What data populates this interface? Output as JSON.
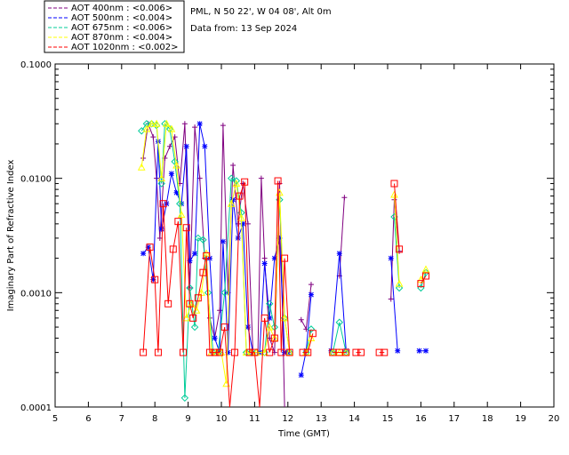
{
  "chart_data": {
    "type": "line",
    "xlabel": "Time (GMT)",
    "ylabel": "Imaginary Part of Refractive Index",
    "xlim": [
      5,
      20
    ],
    "ylim": [
      0.0001,
      0.1
    ],
    "yscale": "log",
    "x_ticks": [
      "5",
      "6",
      "7",
      "8",
      "9",
      "10",
      "11",
      "12",
      "13",
      "14",
      "15",
      "16",
      "17",
      "18",
      "19",
      "20"
    ],
    "y_ticks": [
      {
        "value": 0.1,
        "label": "0.1000"
      },
      {
        "value": 0.01,
        "label": "0.0100"
      },
      {
        "value": 0.001,
        "label": "0.0010"
      },
      {
        "value": 0.0001,
        "label": "0.0001"
      }
    ],
    "info_lines": [
      "PML, N 50 22', W 04 08', Alt 0m",
      "Data from: 13 Sep 2024"
    ],
    "legend_position": "top-left-outside",
    "series": [
      {
        "name": "AOT  400nm : <0.006>",
        "color": "#800080",
        "marker": "plus",
        "segments": [
          [
            [
              7.65,
              0.015
            ],
            [
              7.8,
              0.03
            ],
            [
              7.95,
              0.023
            ],
            [
              8.05,
              0.01
            ],
            [
              8.15,
              0.003
            ],
            [
              8.3,
              0.015
            ],
            [
              8.45,
              0.019
            ],
            [
              8.6,
              0.023
            ],
            [
              8.75,
              0.009
            ],
            [
              8.9,
              0.03
            ],
            [
              9.05,
              0.0011
            ],
            [
              9.2,
              0.028
            ],
            [
              9.35,
              0.01
            ],
            [
              9.5,
              0.002
            ],
            [
              9.65,
              0.0006
            ],
            [
              9.8,
              0.0004
            ],
            [
              9.95,
              0.0007
            ],
            [
              10.05,
              0.029
            ],
            [
              10.2,
              0.001
            ],
            [
              10.35,
              0.013
            ],
            [
              10.5,
              0.004
            ],
            [
              10.65,
              0.009
            ],
            [
              10.8,
              0.004
            ],
            [
              10.95,
              0.0003
            ],
            [
              11.1,
              0.0003
            ],
            [
              11.2,
              0.01
            ],
            [
              11.3,
              0.002
            ],
            [
              11.45,
              0.0004
            ],
            [
              11.6,
              0.0003
            ],
            [
              11.75,
              0.009
            ],
            [
              11.9,
              6e-05
            ]
          ],
          [
            [
              12.4,
              0.00058
            ],
            [
              12.55,
              0.00048
            ],
            [
              12.7,
              0.00118
            ]
          ],
          [
            [
              13.55,
              0.0014
            ],
            [
              13.7,
              0.0068
            ]
          ],
          [
            [
              15.1,
              0.00088
            ],
            [
              15.2,
              0.0065
            ],
            [
              15.35,
              0.0023
            ]
          ]
        ]
      },
      {
        "name": "AOT  500nm : <0.004>",
        "color": "#0000ff",
        "marker": "star",
        "segments": [
          [
            [
              7.65,
              0.0022
            ],
            [
              7.8,
              0.0025
            ],
            [
              7.95,
              0.0013
            ],
            [
              8.1,
              0.021
            ],
            [
              8.2,
              0.0036
            ],
            [
              8.35,
              0.006
            ],
            [
              8.5,
              0.011
            ],
            [
              8.65,
              0.0075
            ],
            [
              8.8,
              0.006
            ],
            [
              8.95,
              0.019
            ],
            [
              9.05,
              0.0019
            ],
            [
              9.2,
              0.0022
            ],
            [
              9.35,
              0.03
            ],
            [
              9.5,
              0.019
            ],
            [
              9.65,
              0.002
            ],
            [
              9.8,
              0.0004
            ],
            [
              9.95,
              0.0003
            ],
            [
              10.05,
              0.0028
            ],
            [
              10.2,
              0.0003
            ],
            [
              10.35,
              0.0065
            ],
            [
              10.5,
              0.003
            ],
            [
              10.65,
              0.004
            ],
            [
              10.8,
              0.0005
            ],
            [
              10.95,
              0.0003
            ],
            [
              11.15,
              0.0003
            ],
            [
              11.3,
              0.0018
            ],
            [
              11.45,
              0.0006
            ],
            [
              11.6,
              0.002
            ],
            [
              11.75,
              0.003
            ],
            [
              11.9,
              0.0003
            ],
            [
              12.0,
              0.0003
            ]
          ],
          [
            [
              12.4,
              0.00019
            ],
            [
              12.55,
              0.00031
            ],
            [
              12.7,
              0.00096
            ]
          ],
          [
            [
              13.3,
              0.00031
            ],
            [
              13.55,
              0.0022
            ],
            [
              13.75,
              0.00031
            ]
          ],
          [
            [
              15.1,
              0.002
            ],
            [
              15.3,
              0.00031
            ]
          ],
          [
            [
              15.95,
              0.00031
            ],
            [
              16.15,
              0.00031
            ]
          ]
        ]
      },
      {
        "name": "AOT  675nm : <0.006>",
        "color": "#00cc99",
        "marker": "diamond",
        "segments": [
          [
            [
              7.6,
              0.026
            ],
            [
              7.75,
              0.03
            ],
            [
              7.9,
              0.03
            ],
            [
              8.05,
              0.029
            ],
            [
              8.2,
              0.009
            ],
            [
              8.3,
              0.03
            ],
            [
              8.45,
              0.027
            ],
            [
              8.6,
              0.014
            ],
            [
              8.75,
              0.006
            ],
            [
              8.9,
              0.00012
            ],
            [
              9.05,
              0.0011
            ],
            [
              9.2,
              0.0005
            ],
            [
              9.3,
              0.003
            ],
            [
              9.45,
              0.0029
            ],
            [
              9.6,
              0.001
            ],
            [
              9.75,
              0.0003
            ],
            [
              9.9,
              0.0003
            ],
            [
              10.1,
              0.001
            ],
            [
              10.3,
              0.01
            ],
            [
              10.45,
              0.0095
            ],
            [
              10.6,
              0.005
            ],
            [
              10.75,
              0.0003
            ],
            [
              10.9,
              0.0003
            ],
            [
              11.05,
              0.0003
            ],
            [
              11.3,
              0.0003
            ],
            [
              11.45,
              0.0008
            ],
            [
              11.6,
              0.0005
            ],
            [
              11.75,
              0.0065
            ],
            [
              11.9,
              0.0006
            ],
            [
              12.05,
              0.0003
            ]
          ],
          [
            [
              12.55,
              0.0003
            ],
            [
              12.7,
              0.00048
            ]
          ],
          [
            [
              13.35,
              0.0003
            ],
            [
              13.55,
              0.00055
            ],
            [
              13.75,
              0.0003
            ]
          ],
          [
            [
              15.2,
              0.0046
            ],
            [
              15.35,
              0.0011
            ]
          ],
          [
            [
              16.0,
              0.0011
            ],
            [
              16.15,
              0.0015
            ]
          ]
        ]
      },
      {
        "name": "AOT  870nm : <0.004>",
        "color": "#ffff00",
        "marker": "triangle",
        "segments": [
          [
            [
              7.6,
              0.0125
            ],
            [
              7.75,
              0.027
            ],
            [
              7.9,
              0.03
            ],
            [
              8.05,
              0.03
            ],
            [
              8.2,
              0.01
            ],
            [
              8.35,
              0.03
            ],
            [
              8.5,
              0.027
            ],
            [
              8.65,
              0.013
            ],
            [
              8.8,
              0.0048
            ],
            [
              8.95,
              0.0006
            ],
            [
              9.1,
              0.0008
            ],
            [
              9.25,
              0.0007
            ],
            [
              9.4,
              0.001
            ],
            [
              9.55,
              0.0022
            ],
            [
              9.7,
              0.0003
            ],
            [
              9.85,
              0.0003
            ],
            [
              10.0,
              0.0003
            ],
            [
              10.15,
              0.00016
            ],
            [
              10.3,
              0.006
            ],
            [
              10.45,
              0.009
            ],
            [
              10.6,
              0.0045
            ],
            [
              10.75,
              0.0003
            ],
            [
              10.9,
              0.0003
            ],
            [
              11.05,
              0.0003
            ],
            [
              11.3,
              0.0003
            ],
            [
              11.45,
              0.0005
            ],
            [
              11.6,
              0.0004
            ],
            [
              11.75,
              0.0075
            ],
            [
              11.9,
              0.0006
            ],
            [
              12.05,
              0.0003
            ]
          ],
          [
            [
              12.55,
              0.0003
            ],
            [
              12.7,
              0.0004
            ]
          ],
          [
            [
              13.35,
              0.0003
            ],
            [
              13.55,
              0.0003
            ],
            [
              13.75,
              0.0003
            ]
          ],
          [
            [
              15.2,
              0.0072
            ],
            [
              15.35,
              0.0012
            ]
          ],
          [
            [
              16.0,
              0.0013
            ],
            [
              16.15,
              0.0016
            ]
          ]
        ]
      },
      {
        "name": "AOT 1020nm : <0.002>",
        "color": "#ff0000",
        "marker": "square",
        "segments": [
          [
            [
              7.65,
              0.0003
            ],
            [
              7.85,
              0.0025
            ],
            [
              8.0,
              0.0013
            ],
            [
              8.1,
              0.0003
            ],
            [
              8.25,
              0.006
            ],
            [
              8.4,
              0.0008
            ],
            [
              8.55,
              0.0024
            ],
            [
              8.7,
              0.0042
            ],
            [
              8.85,
              0.0003
            ],
            [
              8.95,
              0.0037
            ],
            [
              9.05,
              0.0008
            ],
            [
              9.15,
              0.0006
            ],
            [
              9.3,
              0.0009
            ],
            [
              9.45,
              0.0015
            ],
            [
              9.55,
              0.0021
            ],
            [
              9.65,
              0.0003
            ],
            [
              9.8,
              0.0003
            ],
            [
              9.95,
              0.0003
            ],
            [
              10.1,
              0.0005
            ],
            [
              10.25,
              7e-05
            ],
            [
              10.4,
              0.0003
            ],
            [
              10.55,
              0.007
            ],
            [
              10.7,
              0.0093
            ],
            [
              10.85,
              0.0003
            ],
            [
              11.0,
              0.0003
            ],
            [
              11.15,
              8e-05
            ],
            [
              11.3,
              0.0006
            ],
            [
              11.45,
              0.0003
            ],
            [
              11.6,
              0.0004
            ],
            [
              11.7,
              0.0095
            ],
            [
              11.8,
              0.0003
            ],
            [
              11.9,
              0.002
            ],
            [
              12.05,
              0.0003
            ]
          ],
          [
            [
              12.45,
              0.0003
            ],
            [
              12.6,
              0.0003
            ],
            [
              12.75,
              0.00044
            ]
          ],
          [
            [
              13.35,
              0.0003
            ],
            [
              13.55,
              0.0003
            ],
            [
              13.75,
              0.0003
            ]
          ],
          [
            [
              14.05,
              0.0003
            ],
            [
              14.2,
              0.0003
            ]
          ],
          [
            [
              14.75,
              0.0003
            ],
            [
              14.9,
              0.0003
            ]
          ],
          [
            [
              15.2,
              0.009
            ],
            [
              15.35,
              0.0024
            ]
          ],
          [
            [
              16.0,
              0.0012
            ],
            [
              16.15,
              0.0014
            ]
          ]
        ]
      }
    ]
  }
}
